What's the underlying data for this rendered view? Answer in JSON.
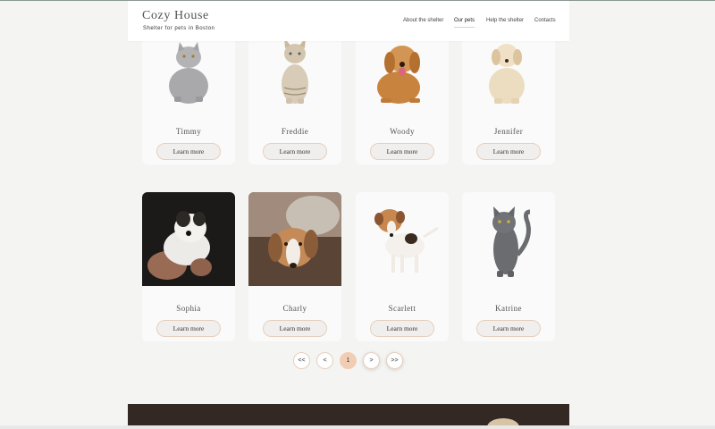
{
  "header": {
    "logo_title": "Cozy House",
    "logo_subtitle": "Shelter for pets in Boston",
    "nav": [
      {
        "label": "About the shelter",
        "active": false
      },
      {
        "label": "Our pets",
        "active": true
      },
      {
        "label": "Help the shelter",
        "active": false
      },
      {
        "label": "Contacts",
        "active": false
      }
    ]
  },
  "pets": [
    {
      "name": "Timmy",
      "button": "Learn more",
      "image": "gray-cat"
    },
    {
      "name": "Freddie",
      "button": "Learn more",
      "image": "tabby-kitten"
    },
    {
      "name": "Woody",
      "button": "Learn more",
      "image": "golden-retriever"
    },
    {
      "name": "Jennifer",
      "button": "Learn more",
      "image": "labrador-puppy"
    },
    {
      "name": "Sophia",
      "button": "Learn more",
      "image": "fluffy-puppy"
    },
    {
      "name": "Charly",
      "button": "Learn more",
      "image": "beagle-blanket"
    },
    {
      "name": "Scarlett",
      "button": "Learn more",
      "image": "jack-russell"
    },
    {
      "name": "Katrine",
      "button": "Learn more",
      "image": "russian-blue-cat"
    }
  ],
  "pagination": {
    "first": "<<",
    "prev": "<",
    "current": "1",
    "next": ">",
    "last": ">>"
  },
  "colors": {
    "accent": "#f1cdb3",
    "background": "#f4f4f3",
    "footer": "#3a2f28"
  }
}
